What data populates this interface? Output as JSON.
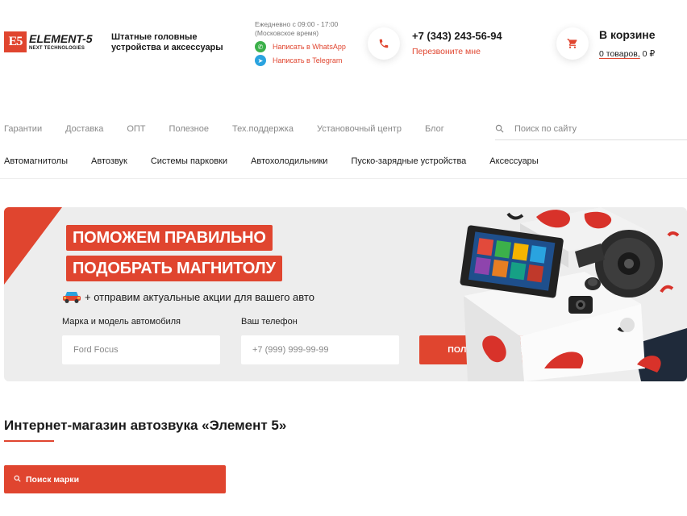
{
  "header": {
    "logo": {
      "badge": "E5",
      "word": "ELEMENT-5",
      "sub": "NEXT TECHNOLOGIES"
    },
    "tagline": "Штатные головные устройства и аксессуары",
    "hours_line1": "Ежедневно с 09:00 - 17:00",
    "hours_line2": "(Московское время)",
    "whatsapp_label": "Написать в WhatsApp",
    "telegram_label": "Написать в Telegram",
    "phone": "+7 (343) 243-56-94",
    "callback_label": "Перезвоните мне",
    "cart_title": "В корзине",
    "cart_items": "0 товаров,",
    "cart_total": " 0 ₽"
  },
  "nav_top": [
    {
      "label": "Гарантии"
    },
    {
      "label": "Доставка"
    },
    {
      "label": "ОПТ"
    },
    {
      "label": "Полезное"
    },
    {
      "label": "Тех.поддержка"
    },
    {
      "label": "Установочный центр"
    },
    {
      "label": "Блог"
    }
  ],
  "search": {
    "placeholder": "Поиск по сайту",
    "icon": "search-icon"
  },
  "nav_catalog": [
    {
      "label": "Автомагнитолы"
    },
    {
      "label": "Автозвук"
    },
    {
      "label": "Системы парковки"
    },
    {
      "label": "Автохолодильники"
    },
    {
      "label": "Пуско-зарядные устройства"
    },
    {
      "label": "Аксессуары"
    }
  ],
  "banner": {
    "headline1": "ПОМОЖЕМ ПРАВИЛЬНО",
    "headline2": "ПОДОБРАТЬ МАГНИТОЛУ",
    "promo": "+ отправим актуальные акции для вашего авто",
    "car_label": "Марка и модель автомобиля",
    "car_placeholder": "Ford Focus",
    "phone_label": "Ваш телефон",
    "phone_placeholder": "+7 (999) 999-99-99",
    "submit_label": "ПОЛУЧИТЬ ВАРИАНТЫ"
  },
  "shop": {
    "title": "Интернет-магазин автозвука «Элемент 5»",
    "brand_search_label": "Поиск марки"
  },
  "colors": {
    "accent": "#e0452f",
    "banner_bg": "#ededed",
    "whatsapp": "#3cb04a",
    "telegram": "#2aa3df"
  }
}
